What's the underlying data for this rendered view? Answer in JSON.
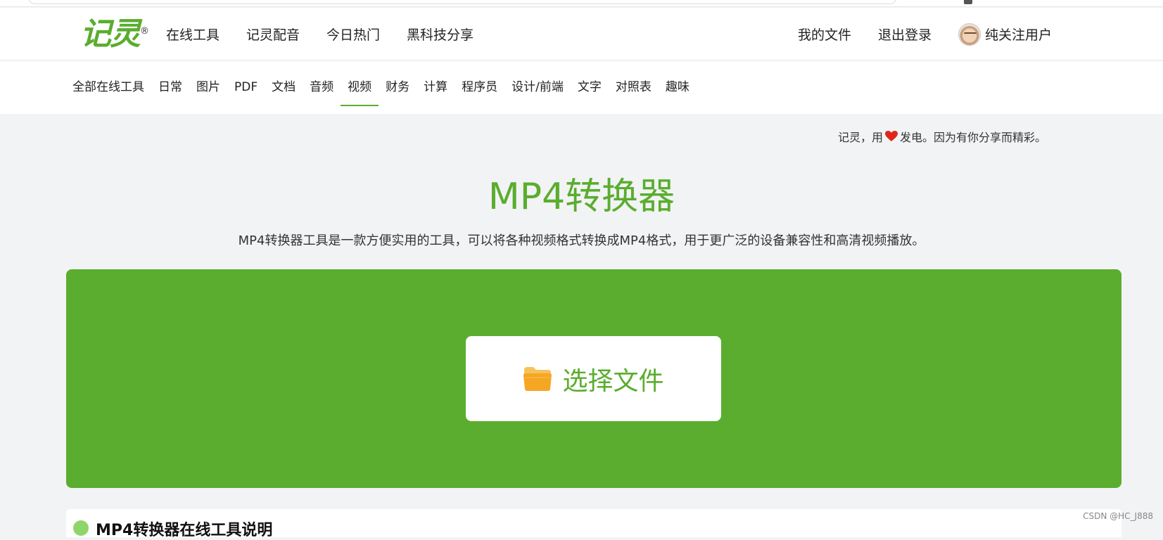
{
  "header": {
    "logo_text": "记灵",
    "logo_reg": "®",
    "nav": [
      "在线工具",
      "记灵配音",
      "今日热门",
      "黑科技分享"
    ],
    "my_files": "我的文件",
    "logout": "退出登录",
    "username": "纯关注用户"
  },
  "categories": {
    "items": [
      "全部在线工具",
      "日常",
      "图片",
      "PDF",
      "文档",
      "音频",
      "视频",
      "财务",
      "计算",
      "程序员",
      "设计/前端",
      "文字",
      "对照表",
      "趣味"
    ],
    "active": "视频"
  },
  "slogan": {
    "before": "记灵，用",
    "after": "发电。因为有你分享而精彩。",
    "heart_icon": "heart-icon"
  },
  "main": {
    "title": "MP4转换器",
    "description": "MP4转换器工具是一款方便实用的工具，可以将各种视频格式转换成MP4格式，用于更广泛的设备兼容性和高清视频播放。",
    "select_file_label": "选择文件",
    "section_title": "MP4转换器在线工具说明"
  },
  "watermark": "CSDN @HC_J888",
  "colors": {
    "brand_green": "#5aad2e",
    "page_bg": "#f2f3f5",
    "folder_orange": "#f5a623",
    "heart_red": "#e0261a"
  }
}
